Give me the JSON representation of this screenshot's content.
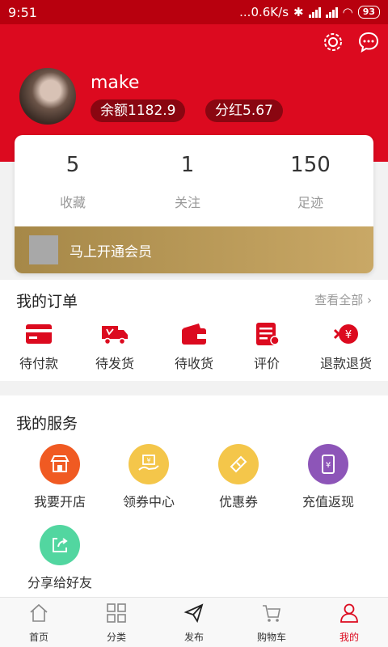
{
  "status": {
    "time": "9:51",
    "network": "...0.6K/s",
    "battery": "93"
  },
  "profile": {
    "username": "make",
    "balance": "余额1182.9",
    "dividend": "分红5.67"
  },
  "stats": [
    {
      "value": "5",
      "label": "收藏"
    },
    {
      "value": "1",
      "label": "关注"
    },
    {
      "value": "150",
      "label": "足迹"
    }
  ],
  "vip": {
    "label": "马上开通会员"
  },
  "orders": {
    "title": "我的订单",
    "view_all": "查看全部",
    "items": [
      {
        "label": "待付款",
        "icon": "card-icon"
      },
      {
        "label": "待发货",
        "icon": "truck-icon"
      },
      {
        "label": "待收货",
        "icon": "wallet-icon"
      },
      {
        "label": "评价",
        "icon": "review-icon"
      },
      {
        "label": "退款退货",
        "icon": "refund-icon"
      }
    ]
  },
  "services": {
    "title": "我的服务",
    "items": [
      {
        "label": "我要开店",
        "icon": "store-icon",
        "color": "#f05a22"
      },
      {
        "label": "领券中心",
        "icon": "coupon-center-icon",
        "color": "#f4c64a"
      },
      {
        "label": "优惠券",
        "icon": "ticket-icon",
        "color": "#f4c64a"
      },
      {
        "label": "充值返现",
        "icon": "phone-yen-icon",
        "color": "#8d55b8"
      },
      {
        "label": "分享给好友",
        "icon": "share-icon",
        "color": "#52d6a0"
      }
    ]
  },
  "tabbar": [
    {
      "label": "首页",
      "icon": "home-icon",
      "active": false
    },
    {
      "label": "分类",
      "icon": "category-icon",
      "active": false
    },
    {
      "label": "发布",
      "icon": "send-icon",
      "active": false
    },
    {
      "label": "购物车",
      "icon": "cart-icon",
      "active": false
    },
    {
      "label": "我的",
      "icon": "user-icon",
      "active": true
    }
  ],
  "colors": {
    "brand": "#dc0a1f",
    "gold": "#c9a866"
  }
}
